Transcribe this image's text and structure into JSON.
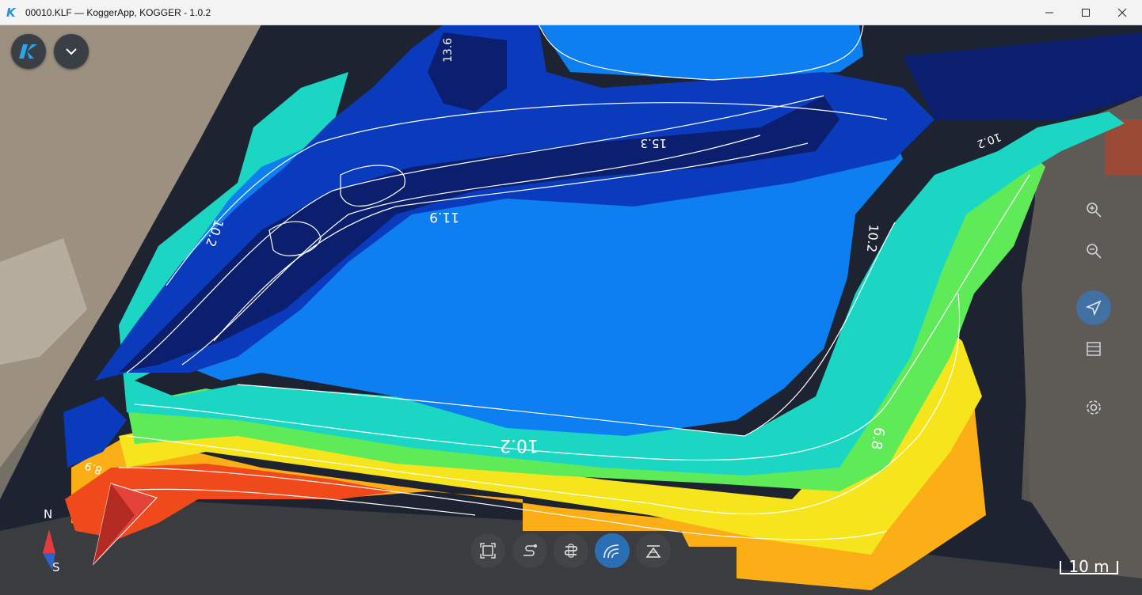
{
  "window": {
    "title": "00010.KLF — KoggerApp, KOGGER - 1.0.2",
    "logo_letter": "K",
    "controls": [
      "minimize-icon",
      "maximize-icon",
      "close-icon"
    ]
  },
  "map": {
    "depth_labels": [
      "13.6",
      "15.3",
      "10.2",
      "11.9",
      "10.2",
      "10.2",
      "10.2",
      "8.9",
      "6.8"
    ],
    "compass": {
      "north": "N",
      "south": "S"
    },
    "scale": {
      "label": "10 m"
    }
  },
  "overlay": {
    "top_left_buttons": [
      "kogger-logo-icon",
      "chevron-down-icon"
    ],
    "right_toolbar": [
      "zoom-in-icon",
      "zoom-out-icon",
      "navigation-arrow-icon",
      "ruler-icon",
      "gear-icon"
    ],
    "bottom_toolbar": [
      "fit-view-icon",
      "track-path-icon",
      "boat-track-icon",
      "bottom-track-icon",
      "surface-icon"
    ],
    "active_bottom_index": 3
  },
  "colors": {
    "deep": "#0b1f6e",
    "mid_deep": "#0a3bbd",
    "mid": "#0e7ff0",
    "shallow_cyan": "#1cd6c4",
    "green": "#5fea58",
    "yellow": "#f6e51c",
    "orange": "#fcae16",
    "red": "#f04a1c",
    "accent": "#3a78be"
  }
}
